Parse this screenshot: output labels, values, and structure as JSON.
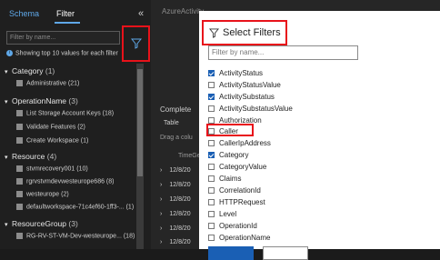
{
  "left_panel": {
    "tabs": {
      "schema": "Schema",
      "filter": "Filter"
    },
    "collapse_icon": "«",
    "search_placeholder": "Filter by name...",
    "info_text": "Showing top 10 values for each filter",
    "groups": [
      {
        "name": "Category",
        "count": "(1)",
        "items": [
          {
            "label": "Administrative (21)"
          }
        ]
      },
      {
        "name": "OperationName",
        "count": "(3)",
        "items": [
          {
            "label": "List Storage Account Keys (18)"
          },
          {
            "label": "Validate Features (2)"
          },
          {
            "label": "Create Workspace (1)"
          }
        ]
      },
      {
        "name": "Resource",
        "count": "(4)",
        "items": [
          {
            "label": "stvmrecovery001 (10)"
          },
          {
            "label": "rgrvstvmdevwesteurope686 (8)"
          },
          {
            "label": "westeurope (2)"
          },
          {
            "label": "defaultworkspace-71c4ef60-1ff3-... (1)"
          }
        ]
      },
      {
        "name": "ResourceGroup",
        "count": "(3)",
        "items": [
          {
            "label": "RG-RV-ST-VM-Dev-westeurope... (18)"
          }
        ]
      }
    ]
  },
  "background": {
    "title": "AzureActivity",
    "completed": "Complete",
    "table_tab": "Table",
    "drag_hint": "Drag a colu",
    "time_col": "TimeGe",
    "rows": [
      "12/8/20",
      "12/8/20",
      "12/8/20",
      "12/8/20",
      "12/8/20",
      "12/8/20"
    ]
  },
  "dialog": {
    "title": "Select Filters",
    "search_placeholder": "Filter by name...",
    "options": [
      {
        "label": "ActivityStatus",
        "checked": true
      },
      {
        "label": "ActivityStatusValue",
        "checked": false
      },
      {
        "label": "ActivitySubstatus",
        "checked": true
      },
      {
        "label": "ActivitySubstatusValue",
        "checked": false
      },
      {
        "label": "Authorization",
        "checked": false
      },
      {
        "label": "Caller",
        "checked": false
      },
      {
        "label": "CallerIpAddress",
        "checked": false
      },
      {
        "label": "Category",
        "checked": true
      },
      {
        "label": "CategoryValue",
        "checked": false
      },
      {
        "label": "Claims",
        "checked": false
      },
      {
        "label": "CorrelationId",
        "checked": false
      },
      {
        "label": "HTTPRequest",
        "checked": false
      },
      {
        "label": "Level",
        "checked": false
      },
      {
        "label": "OperationId",
        "checked": false
      },
      {
        "label": "OperationName",
        "checked": false
      }
    ]
  },
  "colors": {
    "highlight": "#e8121a",
    "accent": "#1a5fb4",
    "link": "#5fa8e8"
  }
}
